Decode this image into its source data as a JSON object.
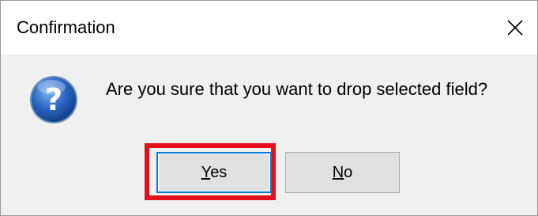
{
  "window": {
    "title": "Confirmation",
    "close_icon": "close-icon"
  },
  "message": {
    "text": "Are you sure that you want to drop selected field?",
    "icon": "question-icon"
  },
  "buttons": {
    "yes": {
      "accel": "Y",
      "rest": "es"
    },
    "no": {
      "accel": "N",
      "rest": "o"
    }
  },
  "colors": {
    "highlight_border": "#e3101c",
    "default_button_border": "#0078d7",
    "icon_blue": "#1e56a8"
  }
}
